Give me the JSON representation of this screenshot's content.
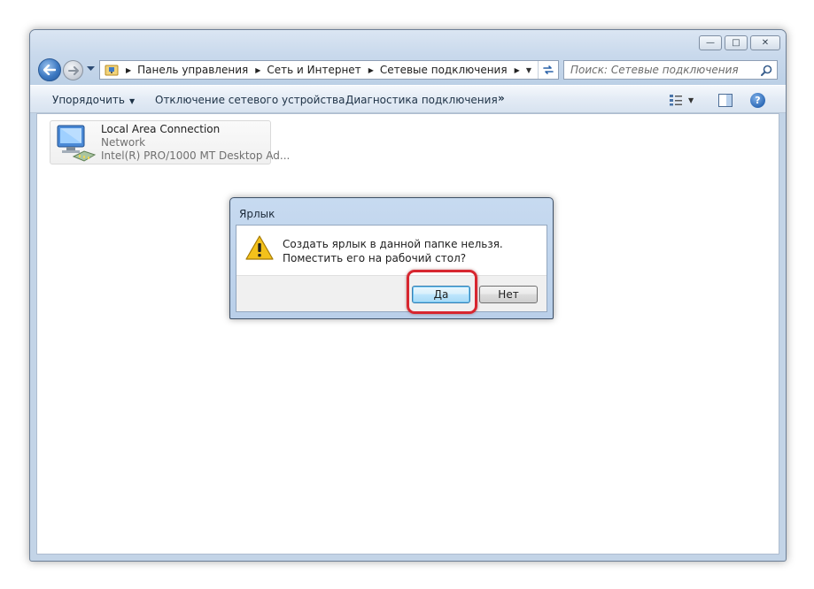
{
  "window": {
    "caption_buttons": {
      "minimize": "—",
      "maximize": "□",
      "close": "✕"
    }
  },
  "navigation": {
    "breadcrumb": [
      "Панель управления",
      "Сеть и Интернет",
      "Сетевые подключения"
    ],
    "search_placeholder": "Поиск: Сетевые подключения"
  },
  "command_bar": {
    "organize_label": "Упорядочить",
    "disable_label": "Отключение сетевого устройства",
    "diagnose_label": "Диагностика подключения",
    "more_label": "»"
  },
  "connection": {
    "name": "Local Area Connection",
    "network": "Network",
    "adapter": "Intel(R) PRO/1000 MT Desktop Ad..."
  },
  "dialog": {
    "title": "Ярлык",
    "message_line1": "Создать ярлык в данной папке нельзя.",
    "message_line2": "Поместить его на рабочий стол?",
    "yes_label": "Да",
    "no_label": "Нет"
  },
  "colors": {
    "highlight": "#d7262f",
    "frame": "#c3d4e7",
    "accent": "#2e6ab6"
  },
  "icons": [
    "back-arrow-icon",
    "forward-arrow-icon",
    "network-folder-icon",
    "refresh-icon",
    "search-icon",
    "view-options-icon",
    "preview-pane-icon",
    "help-icon",
    "network-adapter-icon",
    "warning-icon"
  ]
}
